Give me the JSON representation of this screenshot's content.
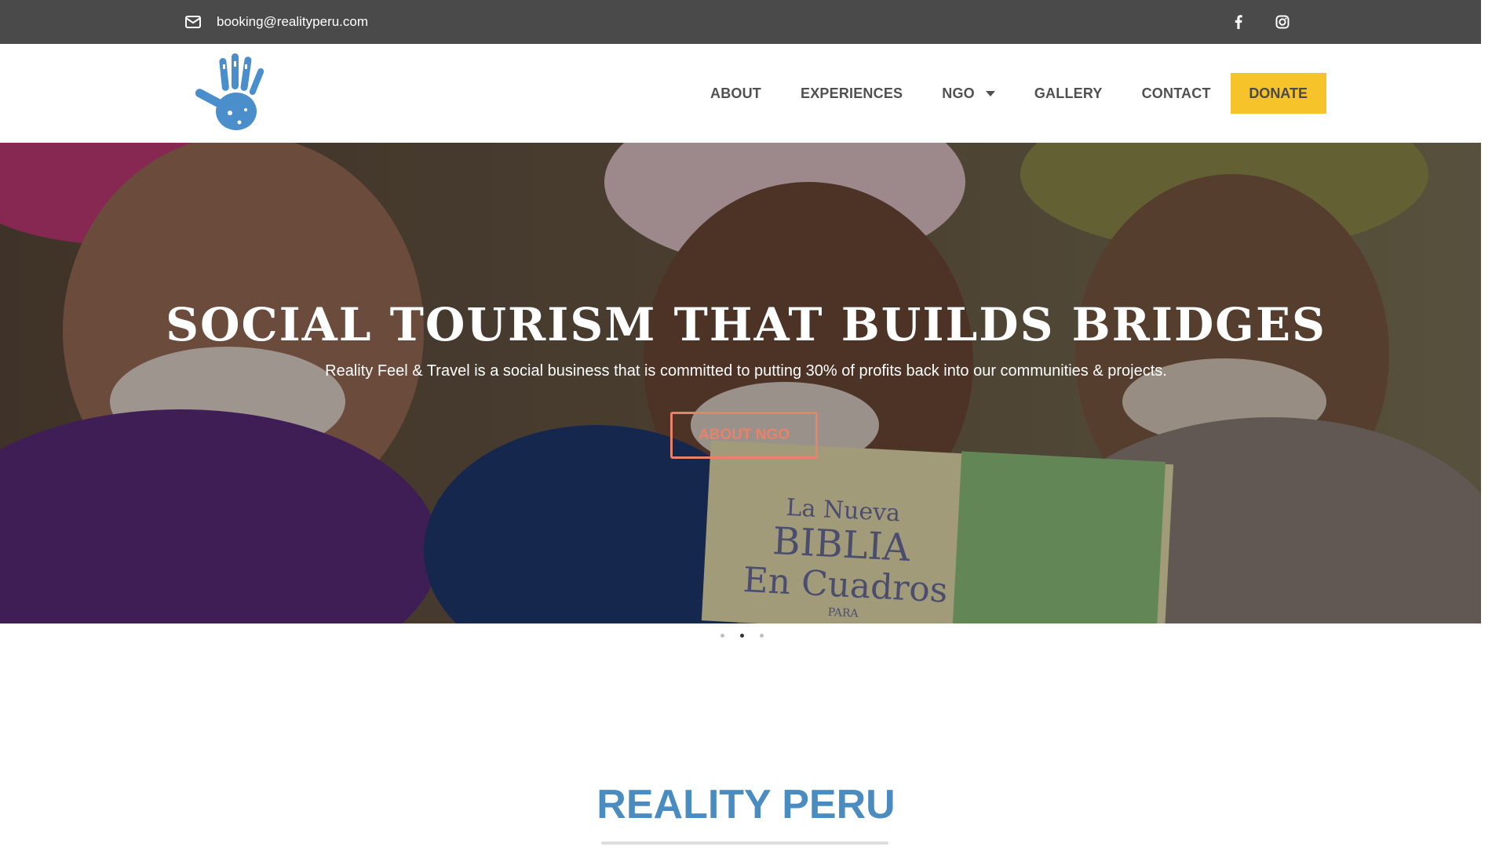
{
  "topbar": {
    "email": "booking@realityperu.com",
    "email_icon": "envelope-icon",
    "social": [
      {
        "name": "facebook-icon"
      },
      {
        "name": "instagram-icon"
      }
    ]
  },
  "header": {
    "logo_icon": "blue-handprint-logo",
    "nav": [
      {
        "label": "ABOUT"
      },
      {
        "label": "EXPERIENCES"
      },
      {
        "label": "NGO",
        "has_dropdown": true
      },
      {
        "label": "GALLERY"
      },
      {
        "label": "CONTACT"
      }
    ],
    "donate_label": "DONATE"
  },
  "hero": {
    "title": "SOCIAL TOURISM THAT BUILDS BRIDGES",
    "subtitle": "Reality Feel & Travel is a social business that is committed to putting 30% of profits back into our communities & projects.",
    "cta_label": "ABOUT NGO",
    "book_text": [
      "La Nueva",
      "BIBLIA",
      "En Cuadros",
      "PARA"
    ],
    "slides": 3,
    "active_slide": 2
  },
  "section": {
    "title": "REALITY PERU"
  },
  "colors": {
    "topbar": "#4a4a4a",
    "donate": "#f6c32a",
    "cta": "#e9826a",
    "section_title": "#4a8bc0"
  }
}
